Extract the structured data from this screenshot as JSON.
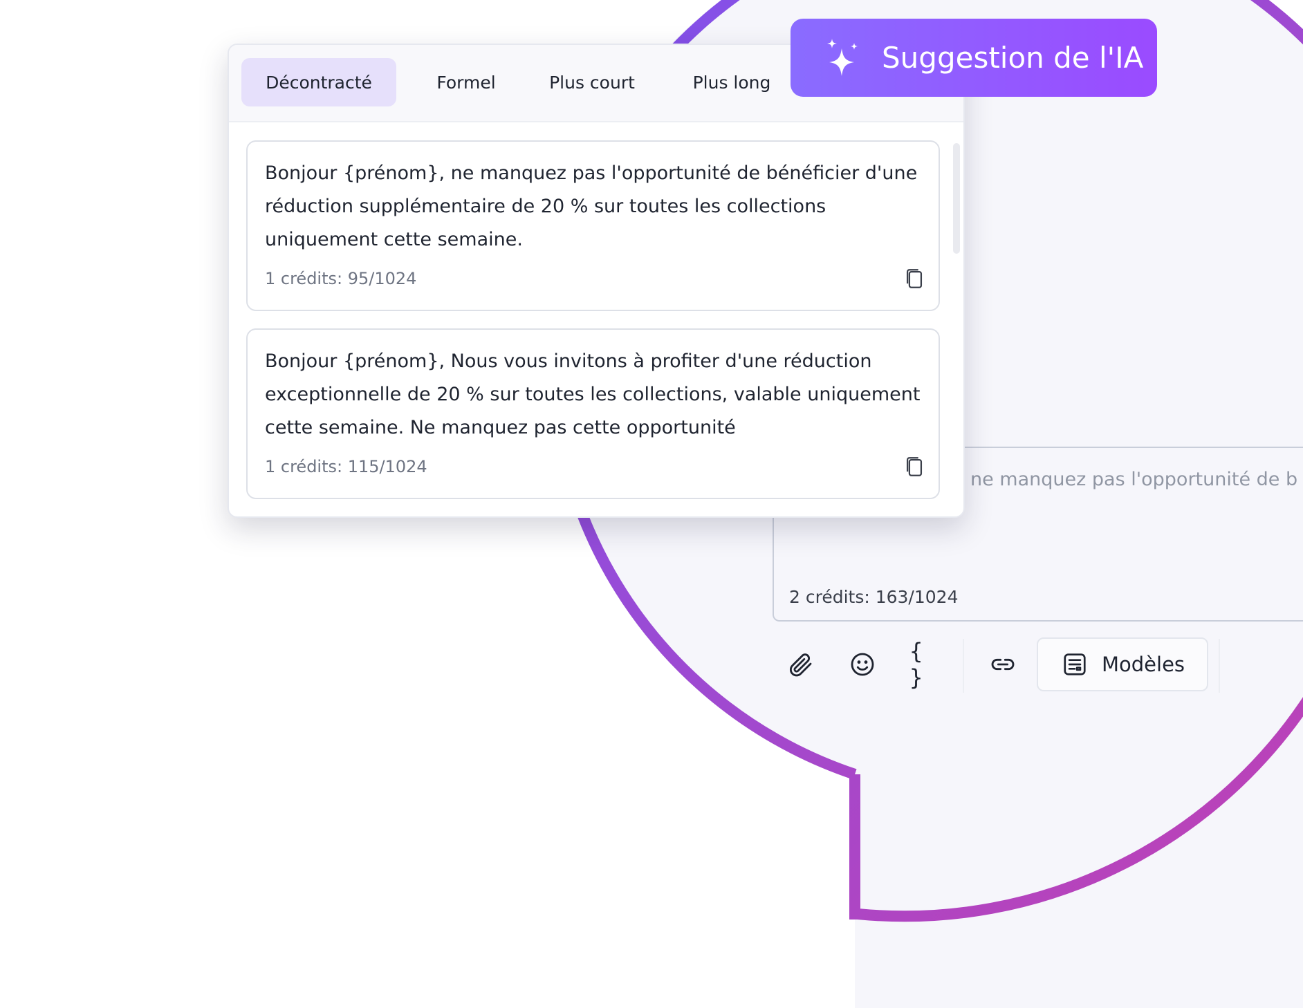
{
  "colors": {
    "accent_start": "#7b53f0",
    "accent_end": "#c63fae",
    "banner_start": "#8a6cff",
    "banner_end": "#9a4bff",
    "active_tab_bg": "#e6e0fb"
  },
  "ai_banner": {
    "icon": "sparkles-icon",
    "label": "Suggestion de l'IA"
  },
  "tabs": [
    {
      "label": "Décontracté",
      "active": true
    },
    {
      "label": "Formel",
      "active": false
    },
    {
      "label": "Plus court",
      "active": false
    },
    {
      "label": "Plus long",
      "active": false
    }
  ],
  "suggestions": [
    {
      "text": "Bonjour {prénom}, ne manquez pas l'opportunité de bénéficier d'une réduction supplémentaire de 20 % sur toutes les collections uniquement cette semaine.",
      "credits": "1 crédits: 95/1024",
      "icon": "copy-icon"
    },
    {
      "text": "Bonjour {prénom}, Nous vous invitons à profiter d'une réduction exceptionnelle de 20 % sur toutes les collections, valable uniquement cette semaine. Ne manquez pas cette opportunité",
      "credits": "1 crédits: 115/1024",
      "icon": "copy-icon"
    }
  ],
  "editor": {
    "text": "ne manquez pas l'opportunité de b",
    "credits": "2 crédits: 163/1024"
  },
  "toolbar": {
    "icons": [
      "paperclip-icon",
      "emoji-icon",
      "braces-icon",
      "link-icon"
    ],
    "braces_glyph": "{ }",
    "models_icon": "template-icon",
    "models_label": "Modèles"
  }
}
